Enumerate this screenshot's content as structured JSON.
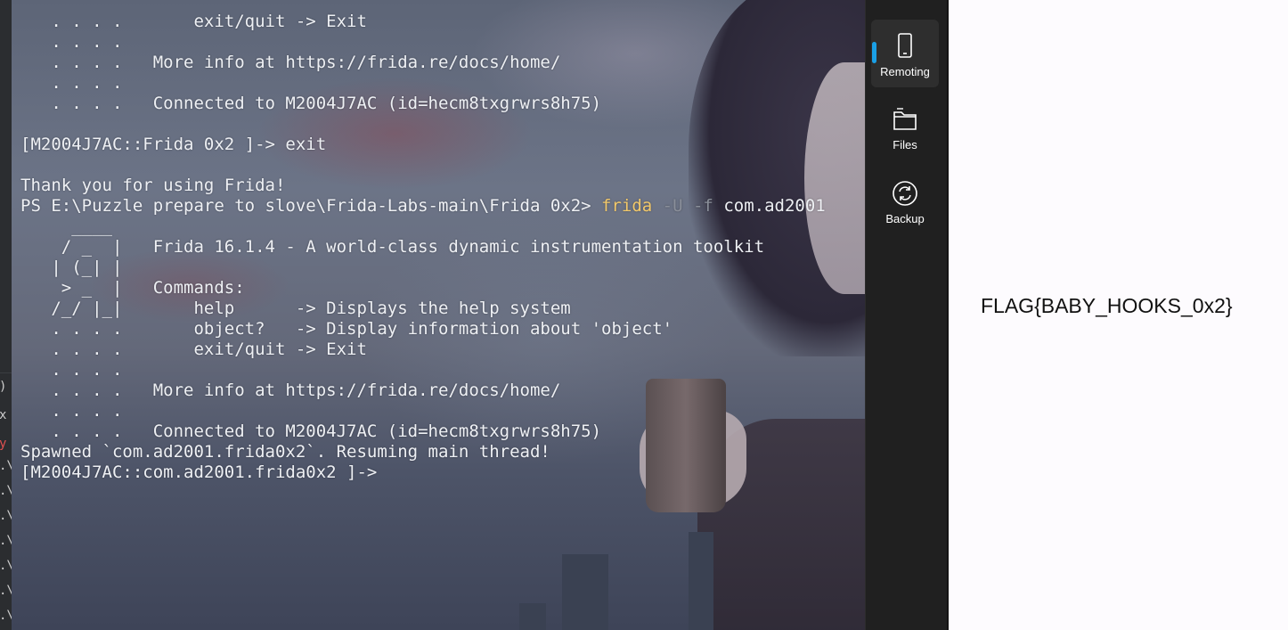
{
  "terminal": {
    "lines": [
      {
        "text": "   . . . .       exit/quit -> Exit"
      },
      {
        "text": "   . . . ."
      },
      {
        "text": "   . . . .   More info at https://frida.re/docs/home/"
      },
      {
        "text": "   . . . ."
      },
      {
        "text": "   . . . .   Connected to M2004J7AC (id=hecm8txgrwrs8h75)"
      },
      {
        "text": ""
      },
      {
        "text": "[M2004J7AC::Frida 0x2 ]-> exit"
      },
      {
        "text": ""
      },
      {
        "text": "Thank you for using Frida!"
      },
      {
        "prompt": "PS E:\\Puzzle prepare to slove\\Frida-Labs-main\\Frida 0x2> ",
        "command": "frida",
        "flags": " -U -f",
        "arg": " com.ad2001"
      },
      {
        "text": "     ____"
      },
      {
        "text": "    / _  |   Frida 16.1.4 - A world-class dynamic instrumentation toolkit"
      },
      {
        "text": "   | (_| |"
      },
      {
        "text": "    > _  |   Commands:"
      },
      {
        "text": "   /_/ |_|       help      -> Displays the help system"
      },
      {
        "text": "   . . . .       object?   -> Display information about 'object'"
      },
      {
        "text": "   . . . .       exit/quit -> Exit"
      },
      {
        "text": "   . . . ."
      },
      {
        "text": "   . . . .   More info at https://frida.re/docs/home/"
      },
      {
        "text": "   . . . ."
      },
      {
        "text": "   . . . .   Connected to M2004J7AC (id=hecm8txgrwrs8h75)"
      },
      {
        "text": "Spawned `com.ad2001.frida0x2`. Resuming main thread!"
      },
      {
        "text": "[M2004J7AC::com.ad2001.frida0x2 ]->"
      }
    ]
  },
  "left_strip": {
    "glyphs": [
      ")",
      "x",
      "y",
      ".\\",
      ".\\",
      ".\\",
      ".\\",
      ".\\",
      ".\\",
      ".\\"
    ]
  },
  "sidebar": {
    "items": [
      {
        "label": "Remoting",
        "icon": "phone-icon",
        "active": true
      },
      {
        "label": "Files",
        "icon": "folder-icon",
        "active": false
      },
      {
        "label": "Backup",
        "icon": "sync-icon",
        "active": false
      }
    ],
    "accent_color": "#1aa0e6"
  },
  "right_pane": {
    "flag": "FLAG{BABY_HOOKS_0x2}"
  },
  "colors": {
    "command": "#f2c86a",
    "terminal_text": "#eef0f4",
    "sidebar_bg": "#202020"
  }
}
